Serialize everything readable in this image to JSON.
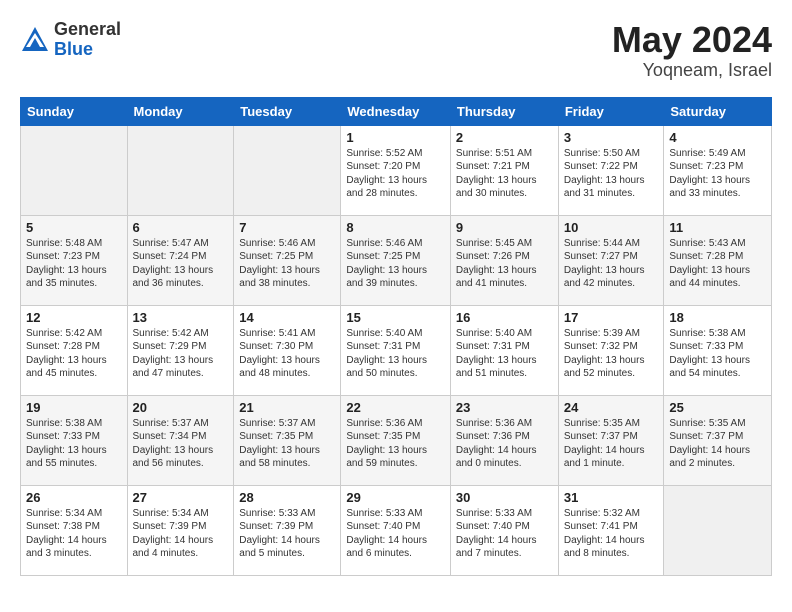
{
  "header": {
    "logo_general": "General",
    "logo_blue": "Blue",
    "month": "May 2024",
    "location": "Yoqneam, Israel"
  },
  "weekdays": [
    "Sunday",
    "Monday",
    "Tuesday",
    "Wednesday",
    "Thursday",
    "Friday",
    "Saturday"
  ],
  "weeks": [
    [
      {
        "day": "",
        "empty": true
      },
      {
        "day": "",
        "empty": true
      },
      {
        "day": "",
        "empty": true
      },
      {
        "day": "1",
        "sunrise": "Sunrise: 5:52 AM",
        "sunset": "Sunset: 7:20 PM",
        "daylight": "Daylight: 13 hours and 28 minutes."
      },
      {
        "day": "2",
        "sunrise": "Sunrise: 5:51 AM",
        "sunset": "Sunset: 7:21 PM",
        "daylight": "Daylight: 13 hours and 30 minutes."
      },
      {
        "day": "3",
        "sunrise": "Sunrise: 5:50 AM",
        "sunset": "Sunset: 7:22 PM",
        "daylight": "Daylight: 13 hours and 31 minutes."
      },
      {
        "day": "4",
        "sunrise": "Sunrise: 5:49 AM",
        "sunset": "Sunset: 7:23 PM",
        "daylight": "Daylight: 13 hours and 33 minutes."
      }
    ],
    [
      {
        "day": "5",
        "sunrise": "Sunrise: 5:48 AM",
        "sunset": "Sunset: 7:23 PM",
        "daylight": "Daylight: 13 hours and 35 minutes."
      },
      {
        "day": "6",
        "sunrise": "Sunrise: 5:47 AM",
        "sunset": "Sunset: 7:24 PM",
        "daylight": "Daylight: 13 hours and 36 minutes."
      },
      {
        "day": "7",
        "sunrise": "Sunrise: 5:46 AM",
        "sunset": "Sunset: 7:25 PM",
        "daylight": "Daylight: 13 hours and 38 minutes."
      },
      {
        "day": "8",
        "sunrise": "Sunrise: 5:46 AM",
        "sunset": "Sunset: 7:25 PM",
        "daylight": "Daylight: 13 hours and 39 minutes."
      },
      {
        "day": "9",
        "sunrise": "Sunrise: 5:45 AM",
        "sunset": "Sunset: 7:26 PM",
        "daylight": "Daylight: 13 hours and 41 minutes."
      },
      {
        "day": "10",
        "sunrise": "Sunrise: 5:44 AM",
        "sunset": "Sunset: 7:27 PM",
        "daylight": "Daylight: 13 hours and 42 minutes."
      },
      {
        "day": "11",
        "sunrise": "Sunrise: 5:43 AM",
        "sunset": "Sunset: 7:28 PM",
        "daylight": "Daylight: 13 hours and 44 minutes."
      }
    ],
    [
      {
        "day": "12",
        "sunrise": "Sunrise: 5:42 AM",
        "sunset": "Sunset: 7:28 PM",
        "daylight": "Daylight: 13 hours and 45 minutes."
      },
      {
        "day": "13",
        "sunrise": "Sunrise: 5:42 AM",
        "sunset": "Sunset: 7:29 PM",
        "daylight": "Daylight: 13 hours and 47 minutes."
      },
      {
        "day": "14",
        "sunrise": "Sunrise: 5:41 AM",
        "sunset": "Sunset: 7:30 PM",
        "daylight": "Daylight: 13 hours and 48 minutes."
      },
      {
        "day": "15",
        "sunrise": "Sunrise: 5:40 AM",
        "sunset": "Sunset: 7:31 PM",
        "daylight": "Daylight: 13 hours and 50 minutes."
      },
      {
        "day": "16",
        "sunrise": "Sunrise: 5:40 AM",
        "sunset": "Sunset: 7:31 PM",
        "daylight": "Daylight: 13 hours and 51 minutes."
      },
      {
        "day": "17",
        "sunrise": "Sunrise: 5:39 AM",
        "sunset": "Sunset: 7:32 PM",
        "daylight": "Daylight: 13 hours and 52 minutes."
      },
      {
        "day": "18",
        "sunrise": "Sunrise: 5:38 AM",
        "sunset": "Sunset: 7:33 PM",
        "daylight": "Daylight: 13 hours and 54 minutes."
      }
    ],
    [
      {
        "day": "19",
        "sunrise": "Sunrise: 5:38 AM",
        "sunset": "Sunset: 7:33 PM",
        "daylight": "Daylight: 13 hours and 55 minutes."
      },
      {
        "day": "20",
        "sunrise": "Sunrise: 5:37 AM",
        "sunset": "Sunset: 7:34 PM",
        "daylight": "Daylight: 13 hours and 56 minutes."
      },
      {
        "day": "21",
        "sunrise": "Sunrise: 5:37 AM",
        "sunset": "Sunset: 7:35 PM",
        "daylight": "Daylight: 13 hours and 58 minutes."
      },
      {
        "day": "22",
        "sunrise": "Sunrise: 5:36 AM",
        "sunset": "Sunset: 7:35 PM",
        "daylight": "Daylight: 13 hours and 59 minutes."
      },
      {
        "day": "23",
        "sunrise": "Sunrise: 5:36 AM",
        "sunset": "Sunset: 7:36 PM",
        "daylight": "Daylight: 14 hours and 0 minutes."
      },
      {
        "day": "24",
        "sunrise": "Sunrise: 5:35 AM",
        "sunset": "Sunset: 7:37 PM",
        "daylight": "Daylight: 14 hours and 1 minute."
      },
      {
        "day": "25",
        "sunrise": "Sunrise: 5:35 AM",
        "sunset": "Sunset: 7:37 PM",
        "daylight": "Daylight: 14 hours and 2 minutes."
      }
    ],
    [
      {
        "day": "26",
        "sunrise": "Sunrise: 5:34 AM",
        "sunset": "Sunset: 7:38 PM",
        "daylight": "Daylight: 14 hours and 3 minutes."
      },
      {
        "day": "27",
        "sunrise": "Sunrise: 5:34 AM",
        "sunset": "Sunset: 7:39 PM",
        "daylight": "Daylight: 14 hours and 4 minutes."
      },
      {
        "day": "28",
        "sunrise": "Sunrise: 5:33 AM",
        "sunset": "Sunset: 7:39 PM",
        "daylight": "Daylight: 14 hours and 5 minutes."
      },
      {
        "day": "29",
        "sunrise": "Sunrise: 5:33 AM",
        "sunset": "Sunset: 7:40 PM",
        "daylight": "Daylight: 14 hours and 6 minutes."
      },
      {
        "day": "30",
        "sunrise": "Sunrise: 5:33 AM",
        "sunset": "Sunset: 7:40 PM",
        "daylight": "Daylight: 14 hours and 7 minutes."
      },
      {
        "day": "31",
        "sunrise": "Sunrise: 5:32 AM",
        "sunset": "Sunset: 7:41 PM",
        "daylight": "Daylight: 14 hours and 8 minutes."
      },
      {
        "day": "",
        "empty": true
      }
    ]
  ]
}
